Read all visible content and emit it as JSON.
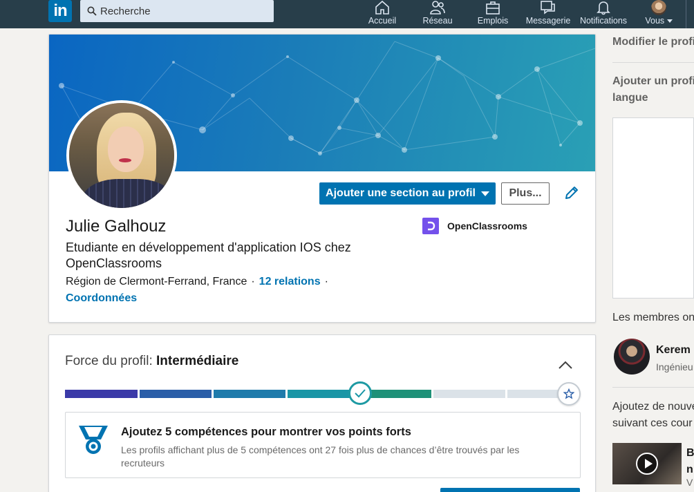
{
  "nav": {
    "logo": "in",
    "search_placeholder": "Recherche",
    "items": [
      {
        "label": "Accueil",
        "icon": "home-icon"
      },
      {
        "label": "Réseau",
        "icon": "network-icon"
      },
      {
        "label": "Emplois",
        "icon": "jobs-icon"
      },
      {
        "label": "Messagerie",
        "icon": "messaging-icon"
      },
      {
        "label": "Notifications",
        "icon": "bell-icon"
      },
      {
        "label": "Vous",
        "icon": "avatar"
      }
    ]
  },
  "profile": {
    "name": "Julie Galhouz",
    "headline": "Etudiante en développement d'application IOS chez OpenClassrooms",
    "location": "Région de Clermont-Ferrand, France",
    "dot": "·",
    "relations": "12 relations",
    "contact": "Coordonnées",
    "company": "OpenClassrooms",
    "add_section_label": "Ajouter une section au profil",
    "more_label": "Plus..."
  },
  "strength": {
    "label": "Force du profil:",
    "level": "Intermédiaire",
    "progress_steps_completed": 4,
    "progress_steps_total": 7,
    "suggestion_title": "Ajoutez 5 compétences pour montrer vos points forts",
    "suggestion_desc": "Les profils affichant plus de 5 compétences ont 27 fois plus de chances d’être trouvés par les recruteurs"
  },
  "rail": {
    "edit_profile": "Modifier le profi",
    "add_profile_lang_1": "Ajouter un profi",
    "add_profile_lang_2": "langue",
    "members_text": "Les membres on",
    "person_name": "Kerem",
    "person_role": "Ingénieu",
    "courses_1": "Ajoutez de nouve",
    "courses_2": "suivant ces cour",
    "video_title_1": "B",
    "video_title_2": "n",
    "video_sub": "V"
  },
  "colors": {
    "nav_bg": "#283e4a",
    "brand_blue": "#0073b1",
    "company_purple": "#7451eb"
  }
}
